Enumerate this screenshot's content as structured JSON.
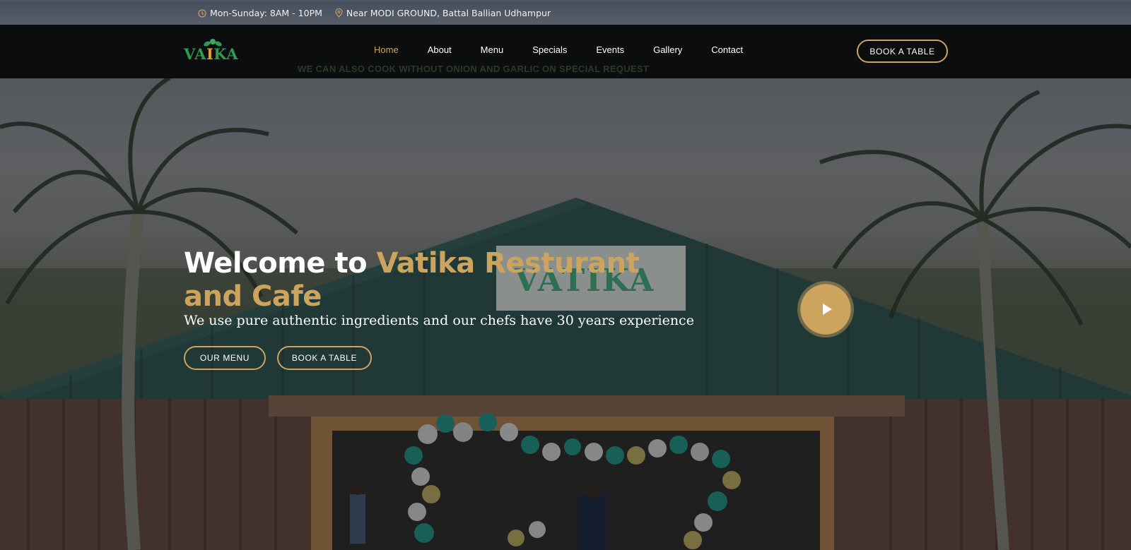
{
  "topbar": {
    "hours": "Mon-Sunday: 8AM - 10PM",
    "address": "Near MODI GROUND, Battal Ballian Udhampur",
    "hours_icon": "clock-icon",
    "address_icon": "map-pin-icon"
  },
  "nav": {
    "logo_text_pre": "VA",
    "logo_text_i": "I",
    "logo_text_post": "KA",
    "items": [
      {
        "label": "Home",
        "active": true
      },
      {
        "label": "About"
      },
      {
        "label": "Menu"
      },
      {
        "label": "Specials"
      },
      {
        "label": "Events"
      },
      {
        "label": "Gallery"
      },
      {
        "label": "Contact"
      }
    ],
    "book_label": "BOOK A TABLE",
    "marquee": "WE CAN ALSO COOK WITHOUT ONION AND GARLIC ON SPECIAL REQUEST"
  },
  "hero": {
    "title_plain": "Welcome to ",
    "title_accent": "Vatika Resturant and Cafe",
    "subtitle": "We use pure authentic ingredients and our chefs have 30 years experience",
    "menu_button": "OUR MENU",
    "book_button": "BOOK A TABLE",
    "play_icon": "play-icon",
    "sign_text": "VATIKA"
  },
  "colors": {
    "accent": "#cda45e",
    "logo_green": "#2e9a52",
    "nav_bg": "#06080a"
  }
}
